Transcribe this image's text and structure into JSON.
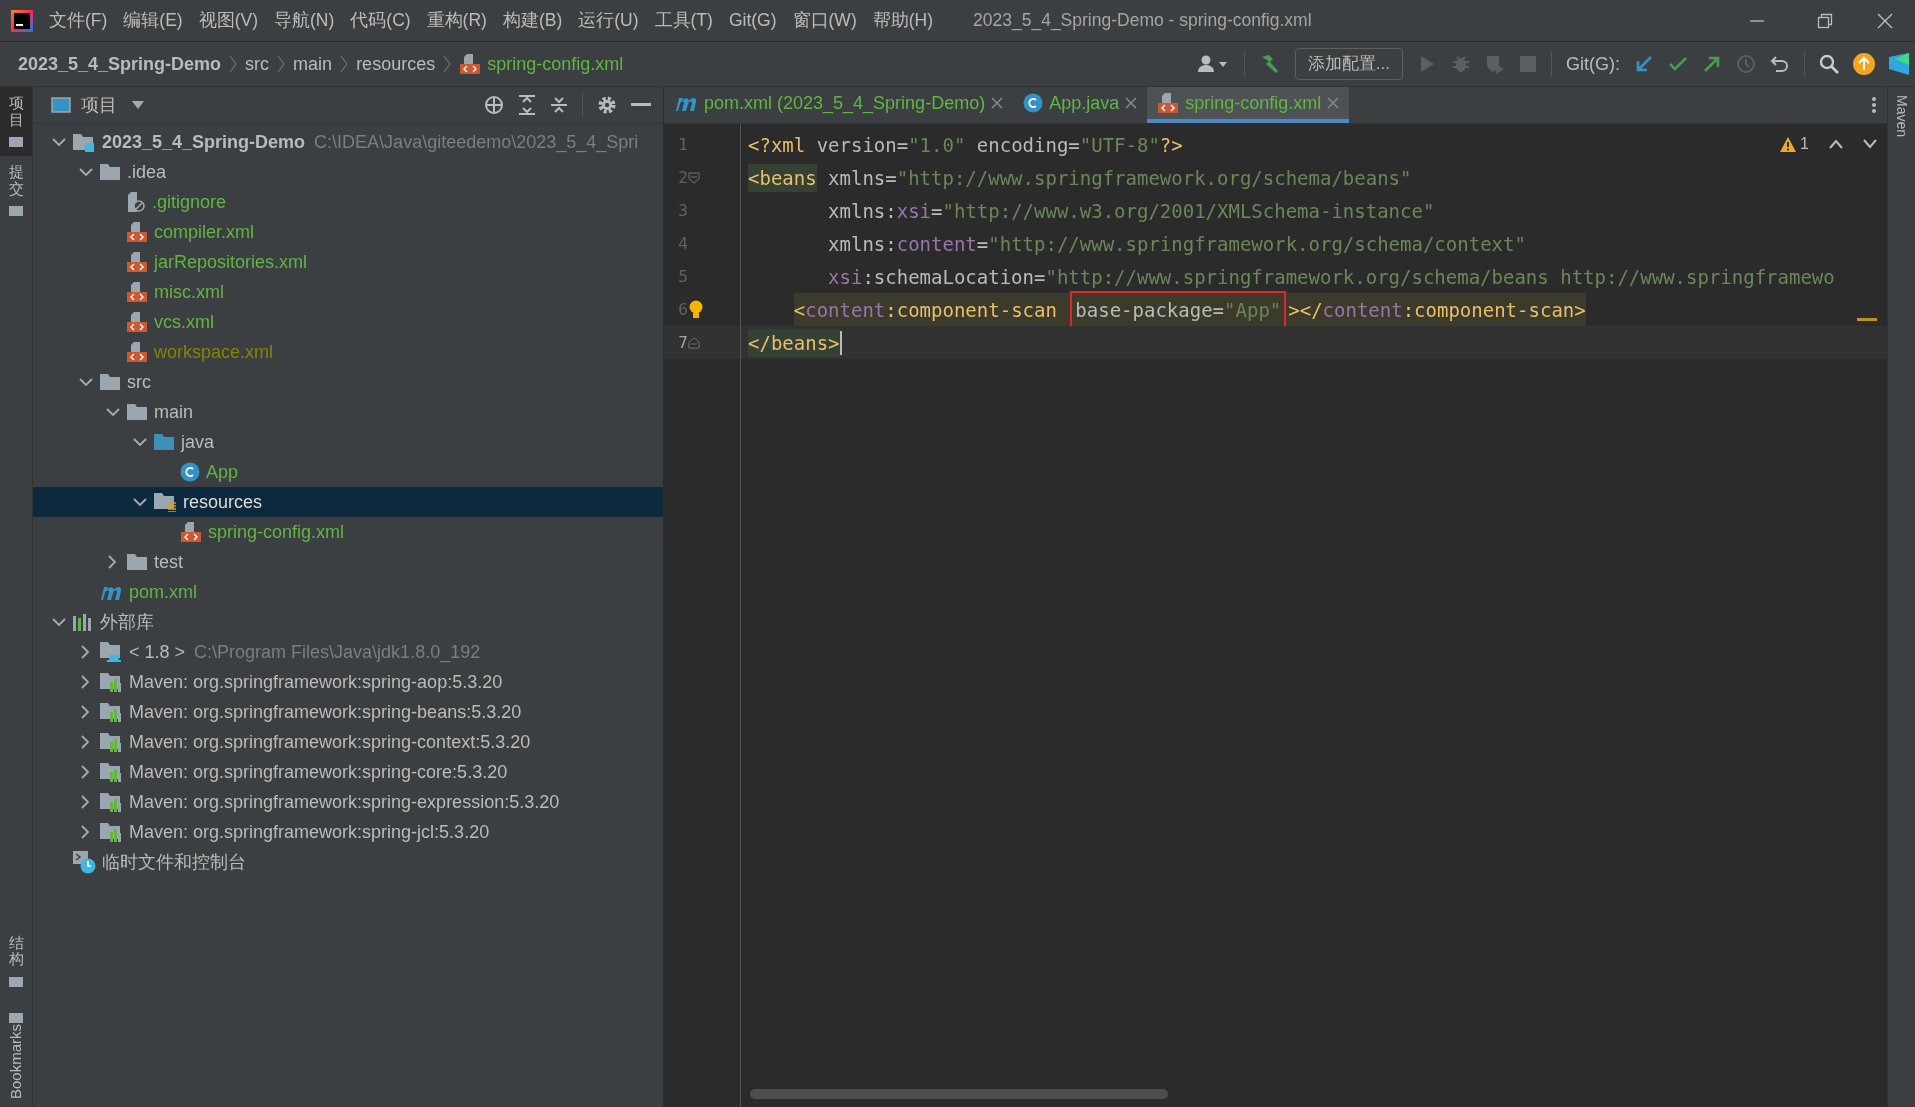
{
  "window": {
    "title": "2023_5_4_Spring-Demo - spring-config.xml"
  },
  "menu": [
    "文件(F)",
    "编辑(E)",
    "视图(V)",
    "导航(N)",
    "代码(C)",
    "重构(R)",
    "构建(B)",
    "运行(U)",
    "工具(T)",
    "Git(G)",
    "窗口(W)",
    "帮助(H)"
  ],
  "breadcrumbs": [
    {
      "label": "2023_5_4_Spring-Demo",
      "kind": "project"
    },
    {
      "label": "src",
      "kind": "folder"
    },
    {
      "label": "main",
      "kind": "folder"
    },
    {
      "label": "resources",
      "kind": "folder"
    },
    {
      "label": "spring-config.xml",
      "kind": "xml"
    }
  ],
  "toolbar": {
    "run_config_button": "添加配置...",
    "git_label": "Git(G):"
  },
  "left_strip": [
    {
      "label": "项目",
      "selected": true
    },
    {
      "label": "提交",
      "selected": false
    },
    {
      "label": "结构",
      "selected": false
    },
    {
      "label": "Bookmarks",
      "selected": false
    }
  ],
  "right_strip": [
    "Maven"
  ],
  "project_panel": {
    "title": "项目",
    "tree": [
      {
        "label": "2023_5_4_Spring-Demo",
        "path": "C:\\IDEA\\Java\\giteedemo\\2023_5_4_Spri",
        "kind": "project",
        "expanded": true,
        "selected": false,
        "children": [
          {
            "label": ".idea",
            "kind": "folder",
            "expanded": true,
            "selected": false,
            "children": [
              {
                "label": ".gitignore",
                "kind": "gitignore",
                "color": "#62b543",
                "selected": false
              },
              {
                "label": "compiler.xml",
                "kind": "xml",
                "color": "#62b543",
                "selected": false
              },
              {
                "label": "jarRepositories.xml",
                "kind": "xml",
                "color": "#62b543",
                "selected": false
              },
              {
                "label": "misc.xml",
                "kind": "xml",
                "color": "#62b543",
                "selected": false
              },
              {
                "label": "vcs.xml",
                "kind": "xml",
                "color": "#62b543",
                "selected": false
              },
              {
                "label": "workspace.xml",
                "kind": "xml",
                "color": "#848504",
                "selected": false
              }
            ]
          },
          {
            "label": "src",
            "kind": "folder",
            "expanded": true,
            "selected": false,
            "children": [
              {
                "label": "main",
                "kind": "folder",
                "expanded": true,
                "selected": false,
                "children": [
                  {
                    "label": "java",
                    "kind": "source-folder",
                    "expanded": true,
                    "selected": false,
                    "children": [
                      {
                        "label": "App",
                        "kind": "class",
                        "color": "#62b543",
                        "selected": false
                      }
                    ]
                  },
                  {
                    "label": "resources",
                    "kind": "resources-folder",
                    "expanded": true,
                    "selected": true,
                    "children": [
                      {
                        "label": "spring-config.xml",
                        "kind": "xml",
                        "color": "#62b543",
                        "selected": false
                      }
                    ]
                  }
                ]
              },
              {
                "label": "test",
                "kind": "folder",
                "expanded": false,
                "selected": false
              }
            ]
          },
          {
            "label": "pom.xml",
            "kind": "maven",
            "color": "#62b543",
            "selected": false
          }
        ]
      },
      {
        "label": "外部库",
        "kind": "library",
        "expanded": true,
        "selected": false,
        "children": [
          {
            "label": "< 1.8 >",
            "path": "C:\\Program Files\\Java\\jdk1.8.0_192",
            "kind": "jdk",
            "expanded": false,
            "selected": false
          },
          {
            "label": "Maven: org.springframework:spring-aop:5.3.20",
            "kind": "maven-lib",
            "expanded": false,
            "selected": false
          },
          {
            "label": "Maven: org.springframework:spring-beans:5.3.20",
            "kind": "maven-lib",
            "expanded": false,
            "selected": false
          },
          {
            "label": "Maven: org.springframework:spring-context:5.3.20",
            "kind": "maven-lib",
            "expanded": false,
            "selected": false
          },
          {
            "label": "Maven: org.springframework:spring-core:5.3.20",
            "kind": "maven-lib",
            "expanded": false,
            "selected": false
          },
          {
            "label": "Maven: org.springframework:spring-expression:5.3.20",
            "kind": "maven-lib",
            "expanded": false,
            "selected": false
          },
          {
            "label": "Maven: org.springframework:spring-jcl:5.3.20",
            "kind": "maven-lib",
            "expanded": false,
            "selected": false
          }
        ]
      },
      {
        "label": "临时文件和控制台",
        "kind": "scratch",
        "selected": false
      }
    ]
  },
  "editor_tabs": [
    {
      "label": "pom.xml (2023_5_4_Spring-Demo)",
      "kind": "maven",
      "selected": false
    },
    {
      "label": "App.java",
      "kind": "class",
      "selected": false
    },
    {
      "label": "spring-config.xml",
      "kind": "xml",
      "selected": true
    }
  ],
  "inspection": {
    "warnings": "1"
  },
  "code_lines": [
    {
      "number": "1",
      "current": false,
      "tokens": [
        {
          "text": "<?xml",
          "kind": "tag"
        },
        {
          "text": " version",
          "kind": "attr"
        },
        {
          "text": "=",
          "kind": "attr"
        },
        {
          "text": "\"1.0\"",
          "kind": "value"
        },
        {
          "text": " encoding",
          "kind": "attr"
        },
        {
          "text": "=",
          "kind": "attr"
        },
        {
          "text": "\"UTF-8\"",
          "kind": "value"
        },
        {
          "text": "?>",
          "kind": "tag"
        }
      ]
    },
    {
      "number": "2",
      "current": false,
      "fold_start": true,
      "tokens": [
        {
          "text": "<beans",
          "kind": "tag",
          "matched": true
        },
        {
          "text": " xmlns",
          "kind": "attr"
        },
        {
          "text": "=",
          "kind": "attr"
        },
        {
          "text": "\"http://www.springframework.org/schema/beans\"",
          "kind": "value"
        }
      ]
    },
    {
      "number": "3",
      "current": false,
      "tokens": [
        {
          "text": "       xmlns:",
          "kind": "attr"
        },
        {
          "text": "xsi",
          "kind": "ns"
        },
        {
          "text": "=",
          "kind": "attr"
        },
        {
          "text": "\"http://www.w3.org/2001/XMLSchema-instance\"",
          "kind": "value"
        }
      ]
    },
    {
      "number": "4",
      "current": false,
      "tokens": [
        {
          "text": "       xmlns:",
          "kind": "attr"
        },
        {
          "text": "content",
          "kind": "ns"
        },
        {
          "text": "=",
          "kind": "attr"
        },
        {
          "text": "\"http://www.springframework.org/schema/context\"",
          "kind": "value"
        }
      ]
    },
    {
      "number": "5",
      "current": false,
      "tokens": [
        {
          "text": "       xsi",
          "kind": "ns"
        },
        {
          "text": ":schemaLocation",
          "kind": "attr"
        },
        {
          "text": "=",
          "kind": "attr"
        },
        {
          "text": "\"http://www.springframework.org/schema/beans http://www.springframewo",
          "kind": "value"
        }
      ]
    },
    {
      "number": "6",
      "current": false,
      "bulb": true,
      "highlighted": true,
      "tokens": [
        {
          "text": "    <",
          "kind": "tag"
        },
        {
          "text": "content",
          "kind": "ns"
        },
        {
          "text": ":component-scan ",
          "kind": "tag"
        },
        {
          "text": "base-package",
          "kind": "attr",
          "boxed": true
        },
        {
          "text": "=",
          "kind": "attr",
          "boxed": true
        },
        {
          "text": "\"App\"",
          "kind": "value",
          "boxed": true
        },
        {
          "text": "></",
          "kind": "tag"
        },
        {
          "text": "content",
          "kind": "ns"
        },
        {
          "text": ":component-scan>",
          "kind": "tag"
        }
      ]
    },
    {
      "number": "7",
      "current": true,
      "fold_end": true,
      "tokens": [
        {
          "text": "</beans>",
          "kind": "tag",
          "matched": true
        }
      ]
    }
  ]
}
